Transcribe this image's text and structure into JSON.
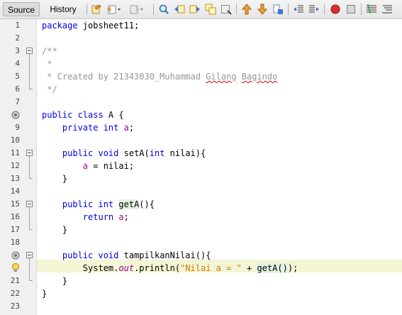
{
  "tabs": [
    {
      "label": "Source",
      "active": true
    },
    {
      "label": "History",
      "active": false
    }
  ],
  "toolbar_icons": [
    "last-edit-icon",
    "back-icon",
    "forward-icon",
    "find-icon",
    "find-previous-icon",
    "find-next-icon",
    "find-selection-icon",
    "toggle-highlight-icon",
    "previous-bookmark-icon",
    "next-bookmark-icon",
    "toggle-bookmark-icon",
    "shift-left-icon",
    "shift-right-icon",
    "record-macro-icon",
    "stop-macro-icon",
    "comment-icon",
    "uncomment-icon"
  ],
  "lines": [
    {
      "n": "1",
      "text": "package jobsheet11;"
    },
    {
      "n": "2",
      "text": ""
    },
    {
      "n": "3",
      "text": "/**"
    },
    {
      "n": "4",
      "text": " *"
    },
    {
      "n": "5",
      "text": " * Created by 21343030_Muhammad Gilang Bagindo"
    },
    {
      "n": "6",
      "text": " */"
    },
    {
      "n": "7",
      "text": ""
    },
    {
      "n": "8",
      "text": "public class A {"
    },
    {
      "n": "9",
      "text": "    private int a;"
    },
    {
      "n": "10",
      "text": ""
    },
    {
      "n": "11",
      "text": "    public void setA(int nilai){"
    },
    {
      "n": "12",
      "text": "        a = nilai;"
    },
    {
      "n": "13",
      "text": "    }"
    },
    {
      "n": "14",
      "text": ""
    },
    {
      "n": "15",
      "text": "    public int getA(){"
    },
    {
      "n": "16",
      "text": "        return a;"
    },
    {
      "n": "17",
      "text": "    }"
    },
    {
      "n": "18",
      "text": ""
    },
    {
      "n": "19",
      "text": "    public void tampilkanNilai(){"
    },
    {
      "n": "20",
      "text": "        System.out.println(\"Nilai a = \" + getA());"
    },
    {
      "n": "21",
      "text": "    }"
    },
    {
      "n": "22",
      "text": "}"
    },
    {
      "n": "23",
      "text": ""
    }
  ],
  "tokens": {
    "l1_kw": "package",
    "l1_rest": " jobsheet11;",
    "l3": "/**",
    "l4": " *",
    "l5_a": " * Created by 21343030_Muhammad ",
    "l5_b": "Gilang",
    "l5_c": " ",
    "l5_d": "Bagindo",
    "l6": " */",
    "l8_kw": "public class",
    "l8_rest": " A {",
    "l9_indent": "    ",
    "l9_kw": "private int",
    "l9_sp": " ",
    "l9_fld": "a",
    "l9_end": ";",
    "l11_indent": "    ",
    "l11_kw": "public void",
    "l11_a": " setA(",
    "l11_kw2": "int",
    "l11_b": " nilai){",
    "l12_indent": "        ",
    "l12_fld": "a",
    "l12_rest": " = nilai;",
    "l13": "    }",
    "l15_indent": "    ",
    "l15_kw": "public int",
    "l15_sp": " ",
    "l15_fn": "getA",
    "l15_rest": "(){",
    "l16_indent": "        ",
    "l16_kw": "return",
    "l16_sp": " ",
    "l16_fld": "a",
    "l16_end": ";",
    "l17": "    }",
    "l19_indent": "    ",
    "l19_kw": "public void",
    "l19_rest": " tampilkanNilai(){",
    "l20_indent": "        ",
    "l20_a": "System.",
    "l20_out": "out",
    "l20_b": ".println(",
    "l20_str": "\"Nilai a = \"",
    "l20_c": " + ",
    "l20_fn": "getA",
    "l20_paren": "()",
    "l20_d": ");",
    "l21": "    }",
    "l22": "}"
  },
  "colors": {
    "keyword": "#0000e6",
    "comment": "#969696",
    "field": "#009900",
    "string": "#ce7b00",
    "current_line": "#f3f5d4"
  }
}
